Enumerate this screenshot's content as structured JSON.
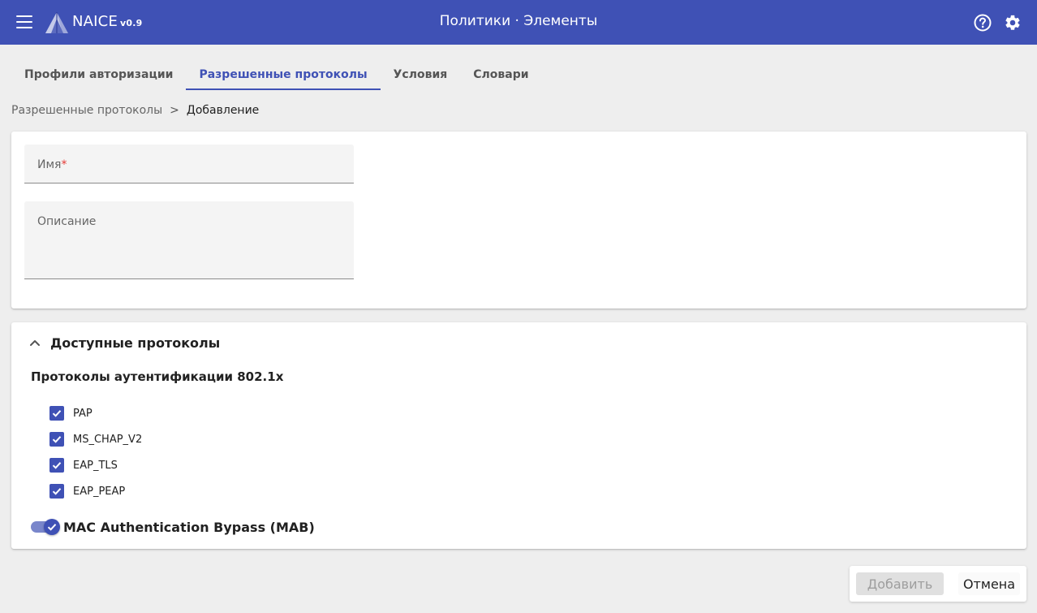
{
  "header": {
    "brand": "NAICE",
    "version": "v0.9",
    "title": "Политики · Элементы",
    "menu_icon": "hamburger-icon",
    "help_icon": "help-circle-icon",
    "settings_icon": "gear-icon",
    "bg_color": "#3f51b5"
  },
  "tabs": [
    {
      "label": "Профили авторизации",
      "active": false
    },
    {
      "label": "Разрешенные протоколы",
      "active": true
    },
    {
      "label": "Условия",
      "active": false
    },
    {
      "label": "Словари",
      "active": false
    }
  ],
  "breadcrumb": {
    "parent": "Разрешенные протоколы",
    "separator": ">",
    "current": "Добавление"
  },
  "form": {
    "name_label": "Имя",
    "required_mark": "*",
    "name_value": "",
    "description_label": "Описание",
    "description_value": ""
  },
  "protocols": {
    "accordion_title": "Доступные протоколы",
    "section_title": "Протоколы аутентификации 802.1x",
    "items": [
      {
        "label": "PAP",
        "checked": true
      },
      {
        "label": "MS_CHAP_V2",
        "checked": true
      },
      {
        "label": "EAP_TLS",
        "checked": true
      },
      {
        "label": "EAP_PEAP",
        "checked": true
      }
    ],
    "mab_label": "MAC Authentication Bypass (MAB)",
    "mab_enabled": true
  },
  "actions": {
    "add_label": "Добавить",
    "add_disabled": true,
    "cancel_label": "Отмена"
  },
  "colors": {
    "accent": "#3f51b5",
    "required": "#e53935"
  }
}
